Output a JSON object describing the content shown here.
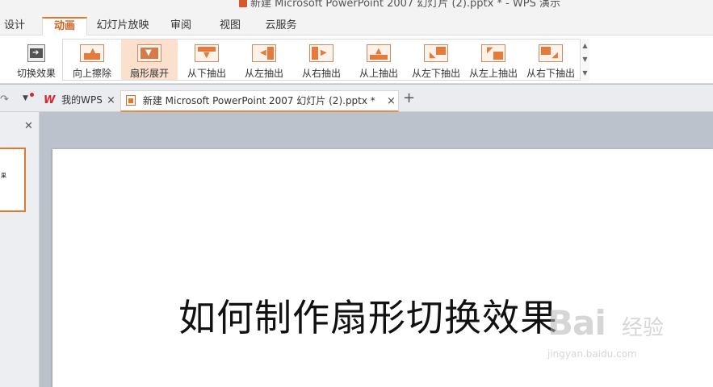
{
  "window": {
    "title": "新建 Microsoft PowerPoint 2007 幻灯片 (2).pptx * - WPS 演示"
  },
  "ribbon_tabs": [
    "设计",
    "动画",
    "幻灯片放映",
    "审阅",
    "视图",
    "云服务"
  ],
  "active_tab": "动画",
  "ribbon": {
    "transition_effects_label": "切换效果",
    "effects": [
      {
        "label": "向上擦除",
        "icon": "wipe-up-icon"
      },
      {
        "label": "扇形展开",
        "icon": "fan-open-icon",
        "selected": true
      },
      {
        "label": "从下抽出",
        "icon": "pull-from-bottom-icon"
      },
      {
        "label": "从左抽出",
        "icon": "pull-from-left-icon"
      },
      {
        "label": "从右抽出",
        "icon": "pull-from-right-icon"
      },
      {
        "label": "从上抽出",
        "icon": "pull-from-top-icon"
      },
      {
        "label": "从左下抽出",
        "icon": "pull-from-bottom-left-icon"
      },
      {
        "label": "从左上抽出",
        "icon": "pull-from-top-left-icon"
      },
      {
        "label": "从右下抽出",
        "icon": "pull-from-bottom-right-icon"
      }
    ]
  },
  "doc_tabs": [
    {
      "label": "我的WPS",
      "active": false
    },
    {
      "label": "新建 Microsoft PowerPoint 2007 幻灯片 (2).pptx *",
      "active": true
    }
  ],
  "slide": {
    "title": "如何制作扇形切换效果",
    "thumb_text": "果"
  },
  "watermark": {
    "logo": "Bai",
    "cn": "经验",
    "url": "jingyan.baidu.com"
  },
  "colors": {
    "accent": "#e0782f",
    "selected_bg": "#fbe0cd",
    "canvas_bg": "#bcc2cc"
  }
}
